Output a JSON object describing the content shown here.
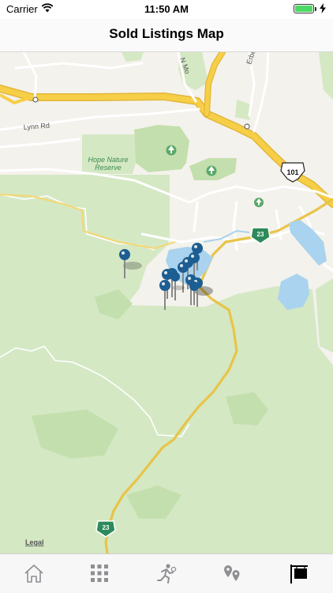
{
  "status_bar": {
    "carrier": "Carrier",
    "time": "11:50 AM"
  },
  "nav": {
    "title": "Sold Listings Map"
  },
  "map": {
    "road_labels": {
      "lynn_rd": "Lynn Rd",
      "n_moorpark": "N Mo",
      "erbes_rd": "Erbes Rd"
    },
    "place_labels": {
      "hope_nature_line1": "Hope Nature",
      "hope_nature_line2": "Reserve"
    },
    "shields": {
      "us101": "101",
      "ca23_a": "23",
      "ca23_b": "23"
    },
    "legal": "Legal",
    "listing_pin_count": 12
  },
  "tab_bar": {
    "items": [
      {
        "name": "home",
        "icon": "home-icon",
        "selected": false
      },
      {
        "name": "grid",
        "icon": "grid-icon",
        "selected": false
      },
      {
        "name": "activity",
        "icon": "person-running-icon",
        "selected": false
      },
      {
        "name": "locations",
        "icon": "map-pins-icon",
        "selected": false
      },
      {
        "name": "sold",
        "icon": "sold-sign-icon",
        "selected": true
      }
    ]
  },
  "colors": {
    "map_land": "#f4f2ec",
    "park_green": "#d4e8c4",
    "park_green_dark": "#bfdca9",
    "highway": "#f7cf47",
    "road_white": "#ffffff",
    "water": "#a9d3ee",
    "pin": "#1d5e92",
    "shield_green": "#2c8a5b",
    "tab_inactive": "#8e8e93",
    "tab_active": "#000000"
  }
}
